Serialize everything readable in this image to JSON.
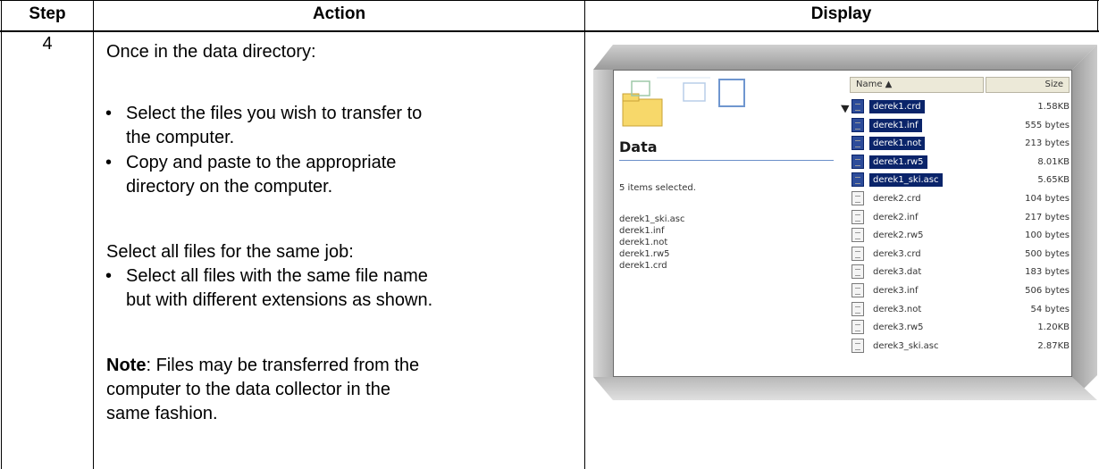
{
  "headers": {
    "step": "Step",
    "action": "Action",
    "display": "Display"
  },
  "row": {
    "step": "4",
    "intro": "Once in the data directory:",
    "bullets_1": [
      [
        "Select the files you wish to transfer to",
        "the computer."
      ],
      [
        "Copy and paste to the appropriate",
        "directory on the computer."
      ]
    ],
    "select_all": "Select all files for the same job:",
    "bullets_2": [
      [
        "Select all files with the same file name",
        "but with different extensions as shown."
      ]
    ],
    "note_label": "Note",
    "note_text": [
      ": Files may be transferred from the",
      "computer to the data collector in the",
      "same fashion."
    ]
  },
  "explorer": {
    "panel_title": "Data",
    "selected_count": "5 items selected.",
    "selected_files": [
      "derek1_ski.asc",
      "derek1.inf",
      "derek1.not",
      "derek1.rw5",
      "derek1.crd"
    ],
    "col_name": "Name ▲",
    "col_size": "Size",
    "files": [
      {
        "name": "derek1.crd",
        "size": "1.58KB",
        "selected": true
      },
      {
        "name": "derek1.inf",
        "size": "555 bytes",
        "selected": true
      },
      {
        "name": "derek1.not",
        "size": "213 bytes",
        "selected": true
      },
      {
        "name": "derek1.rw5",
        "size": "8.01KB",
        "selected": true
      },
      {
        "name": "derek1_ski.asc",
        "size": "5.65KB",
        "selected": true
      },
      {
        "name": "derek2.crd",
        "size": "104 bytes",
        "selected": false
      },
      {
        "name": "derek2.inf",
        "size": "217 bytes",
        "selected": false
      },
      {
        "name": "derek2.rw5",
        "size": "100 bytes",
        "selected": false
      },
      {
        "name": "derek3.crd",
        "size": "500 bytes",
        "selected": false
      },
      {
        "name": "derek3.dat",
        "size": "183 bytes",
        "selected": false
      },
      {
        "name": "derek3.inf",
        "size": "506 bytes",
        "selected": false
      },
      {
        "name": "derek3.not",
        "size": "54 bytes",
        "selected": false
      },
      {
        "name": "derek3.rw5",
        "size": "1.20KB",
        "selected": false
      },
      {
        "name": "derek3_ski.asc",
        "size": "2.87KB",
        "selected": false
      }
    ]
  }
}
